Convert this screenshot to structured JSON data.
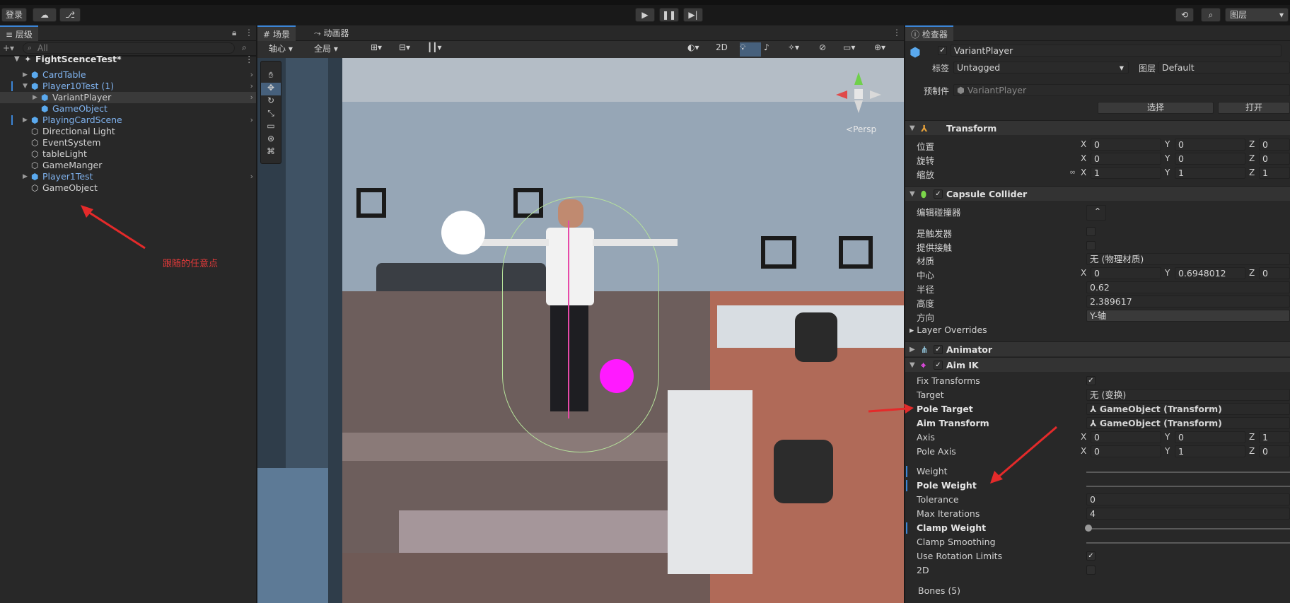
{
  "toolbar": {
    "login": "登录",
    "layers_dropdown": "图层"
  },
  "hierarchy": {
    "tab_label": "层级",
    "search_placeholder": "All",
    "scene_name": "FightScenceTest*",
    "items": [
      {
        "label": "CardTable",
        "type": "prefab"
      },
      {
        "label": "Player10Test (1)",
        "type": "prefab"
      },
      {
        "label": "VariantPlayer",
        "type": "prefab-plain"
      },
      {
        "label": "GameObject",
        "type": "prefab"
      },
      {
        "label": "PlayingCardScene",
        "type": "prefab"
      },
      {
        "label": "Directional Light",
        "type": "plain"
      },
      {
        "label": "EventSystem",
        "type": "plain"
      },
      {
        "label": "tableLight",
        "type": "plain"
      },
      {
        "label": "GameManger",
        "type": "plain"
      },
      {
        "label": "Player1Test",
        "type": "prefab"
      },
      {
        "label": "GameObject",
        "type": "plain"
      }
    ],
    "annotation": "跟随的任意点"
  },
  "scene_view": {
    "tab_scene": "场景",
    "tab_animator": "动画器",
    "pivot": "轴心",
    "global": "全局",
    "mode_2d": "2D",
    "persp": "Persp"
  },
  "inspector": {
    "tab_label": "检查器",
    "object_name": "VariantPlayer",
    "tag_label": "标签",
    "tag_value": "Untagged",
    "layer_label": "图层",
    "layer_value": "Default",
    "prefab_label": "预制件",
    "prefab_value": "VariantPlayer",
    "select_button": "选择",
    "open_button": "打开",
    "transform": {
      "title": "Transform",
      "position_label": "位置",
      "rotation_label": "旋转",
      "scale_label": "缩放",
      "position": [
        "0",
        "0",
        "0"
      ],
      "rotation": [
        "0",
        "0",
        "0"
      ],
      "scale": [
        "1",
        "1",
        "1"
      ]
    },
    "capsule": {
      "title": "Capsule Collider",
      "edit_collider": "编辑碰撞器",
      "is_trigger": "是触发器",
      "provides_contacts": "提供接触",
      "material_label": "材质",
      "material_value": "无 (物理材质)",
      "center_label": "中心",
      "center": [
        "0",
        "0.6948012",
        "0"
      ],
      "radius_label": "半径",
      "radius_value": "0.62",
      "height_label": "高度",
      "height_value": "2.389617",
      "direction_label": "方向",
      "direction_value": "Y-轴",
      "layer_overrides": "Layer Overrides"
    },
    "animator": {
      "title": "Animator"
    },
    "aimik": {
      "title": "Aim IK",
      "fix_transforms": "Fix Transforms",
      "target_label": "Target",
      "target_value": "无 (变换)",
      "pole_target_label": "Pole Target",
      "pole_target_value": "GameObject (Transform)",
      "aim_transform_label": "Aim Transform",
      "aim_transform_value": "GameObject (Transform)",
      "axis_label": "Axis",
      "axis": [
        "0",
        "0",
        "1"
      ],
      "pole_axis_label": "Pole Axis",
      "pole_axis": [
        "0",
        "1",
        "0"
      ],
      "weight_label": "Weight",
      "pole_weight_label": "Pole Weight",
      "tolerance_label": "Tolerance",
      "tolerance_value": "0",
      "max_iter_label": "Max Iterations",
      "max_iter_value": "4",
      "clamp_weight_label": "Clamp Weight",
      "clamp_smoothing_label": "Clamp Smoothing",
      "use_rotation_limits_label": "Use Rotation Limits",
      "two_d_label": "2D",
      "bones_label": "Bones (5)"
    },
    "axis_letters": [
      "X",
      "Y",
      "Z"
    ]
  }
}
